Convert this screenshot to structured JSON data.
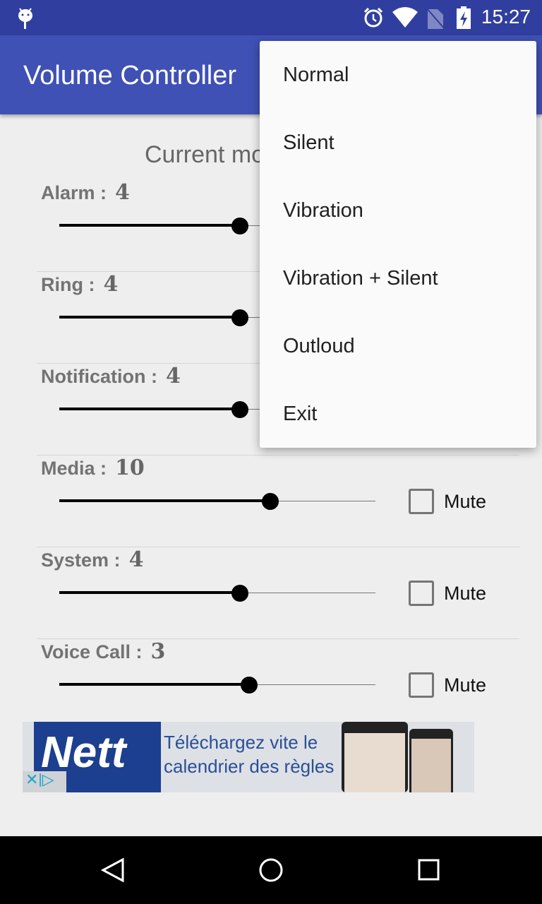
{
  "status": {
    "time": "15:27",
    "icons": [
      "android-debug-icon",
      "alarm-icon",
      "wifi-icon",
      "no-sim-icon",
      "battery-charging-icon"
    ]
  },
  "app": {
    "title": "Volume Controller",
    "current_mode": "Current mode : Normal"
  },
  "streams": [
    {
      "label": "Alarm :",
      "value": "4",
      "max": 7,
      "mute": null
    },
    {
      "label": "Ring :",
      "value": "4",
      "max": 7,
      "mute": null
    },
    {
      "label": "Notification :",
      "value": "4",
      "max": 7,
      "mute": null
    },
    {
      "label": "Media :",
      "value": "10",
      "max": 15,
      "mute": "Mute",
      "muted": false
    },
    {
      "label": "System :",
      "value": "4",
      "max": 7,
      "mute": "Mute",
      "muted": false
    },
    {
      "label": "Voice Call :",
      "value": "3",
      "max": 5,
      "mute": "Mute",
      "muted": false
    }
  ],
  "ad": {
    "brand": "Nett",
    "line1": "Téléchargez vite le",
    "line2": "calendrier des règles"
  },
  "menu": {
    "items": [
      "Normal",
      "Silent",
      "Vibration",
      "Vibration + Silent",
      "Outloud",
      "Exit"
    ]
  },
  "nav": {
    "icons": [
      "back-icon",
      "home-icon",
      "recents-icon"
    ]
  }
}
